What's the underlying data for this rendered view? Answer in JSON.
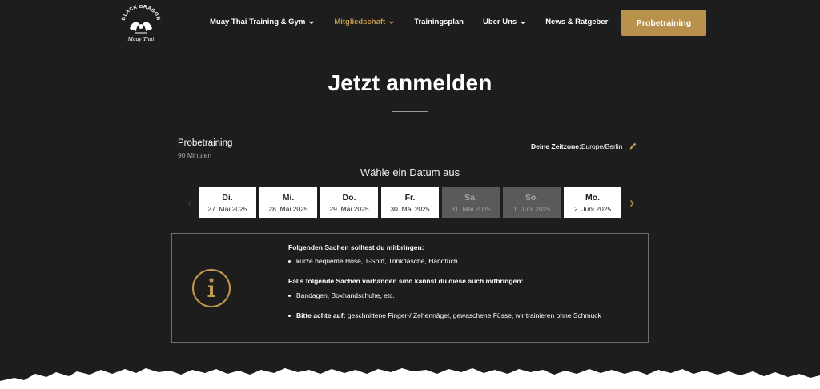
{
  "logo": {
    "top_text": "BLACK DRAGON",
    "script_text": "Muay Thai",
    "icon": "dragon-logo-icon"
  },
  "nav": {
    "items": [
      {
        "label": "Muay Thai Training & Gym",
        "dropdown": true
      },
      {
        "label": "Mitgliedschaft",
        "dropdown": true,
        "active": true
      },
      {
        "label": "Trainingsplan",
        "dropdown": false
      },
      {
        "label": "Über Uns",
        "dropdown": true
      },
      {
        "label": "News & Ratgeber",
        "dropdown": false
      }
    ],
    "cta_label": "Probetraining"
  },
  "page_title": "Jetzt anmelden",
  "booking": {
    "service_name": "Probetraining",
    "service_duration": "90 Minuten",
    "timezone_label": "Deine Zeitzone:",
    "timezone_value": "Europe/Berlin",
    "pick_date_title": "Wähle ein Datum aus",
    "dates": [
      {
        "day": "Di.",
        "date": "27. Mai 2025",
        "disabled": false
      },
      {
        "day": "Mi.",
        "date": "28. Mai 2025",
        "disabled": false
      },
      {
        "day": "Do.",
        "date": "29. Mai 2025",
        "disabled": false
      },
      {
        "day": "Fr.",
        "date": "30. Mai 2025",
        "disabled": false
      },
      {
        "day": "Sa.",
        "date": "31. Mai 2025",
        "disabled": true
      },
      {
        "day": "So.",
        "date": "1. Juni 2025",
        "disabled": true
      },
      {
        "day": "Mo.",
        "date": "2. Juni 2025",
        "disabled": false
      }
    ]
  },
  "info": {
    "heading1": "Folgenden Sachen solltest du mitbringen:",
    "list1": [
      "kurze bequeme Hose, T-Shirt, Trinkflasche, Handtuch"
    ],
    "heading2": "Falls folgende Sachen vorhanden sind kannst du diese auch mitbringen:",
    "list2": [
      "Bandagen, Boxhandschuhe, etc."
    ],
    "note_bold": "Bitte achte auf:",
    "note_text": " geschnittene Finger-/ Zehennägel, gewaschene Füsse, wir trainieren ohne Schmuck"
  },
  "colors": {
    "background": "#1d1d1d",
    "accent": "#b8924d",
    "active_nav": "#c0984f",
    "disabled_date": "#5a5a5a"
  }
}
